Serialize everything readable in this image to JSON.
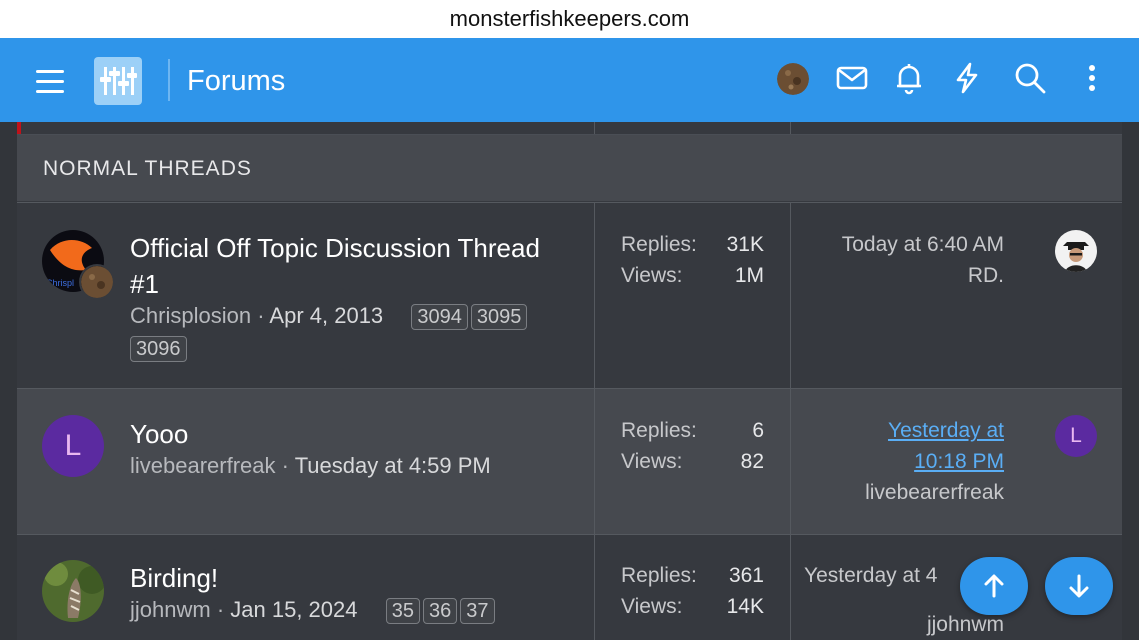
{
  "browser": {
    "url": "monsterfishkeepers.com"
  },
  "header": {
    "title": "Forums",
    "icons": [
      "menu-icon",
      "logo-icon",
      "user-avatar",
      "mail-icon",
      "bell-icon",
      "lightning-icon",
      "search-icon",
      "more-icon"
    ]
  },
  "section": {
    "title": "NORMAL THREADS"
  },
  "threads": [
    {
      "title": "Official Off Topic Discussion Thread #1",
      "author": "Chrisplosion",
      "date": "Apr 4, 2013",
      "pages": [
        "3094",
        "3095",
        "3096"
      ],
      "replies_label": "Replies:",
      "replies": "31K",
      "views_label": "Views:",
      "views": "1M",
      "last_time": "Today at 6:40 AM",
      "last_user": "RD."
    },
    {
      "title": "Yooo",
      "author": "livebearerfreak",
      "date": "Tuesday at 4:59 PM",
      "avatar_letter": "L",
      "replies_label": "Replies:",
      "replies": "6",
      "views_label": "Views:",
      "views": "82",
      "last_time_line1": "Yesterday at",
      "last_time_line2": "10:18 PM",
      "last_user": "livebearerfreak",
      "last_avatar_letter": "L"
    },
    {
      "title": "Birding!",
      "author": "jjohnwm",
      "date": "Jan 15, 2024",
      "pages": [
        "35",
        "36",
        "37"
      ],
      "replies_label": "Replies:",
      "replies": "361",
      "views_label": "Views:",
      "views": "14K",
      "last_time": "Yesterday at 4",
      "last_user": "jjohnwm"
    }
  ],
  "colors": {
    "accent": "#2f95ea",
    "avatar_purple": "#5b2aa0",
    "link": "#5aaef5"
  }
}
